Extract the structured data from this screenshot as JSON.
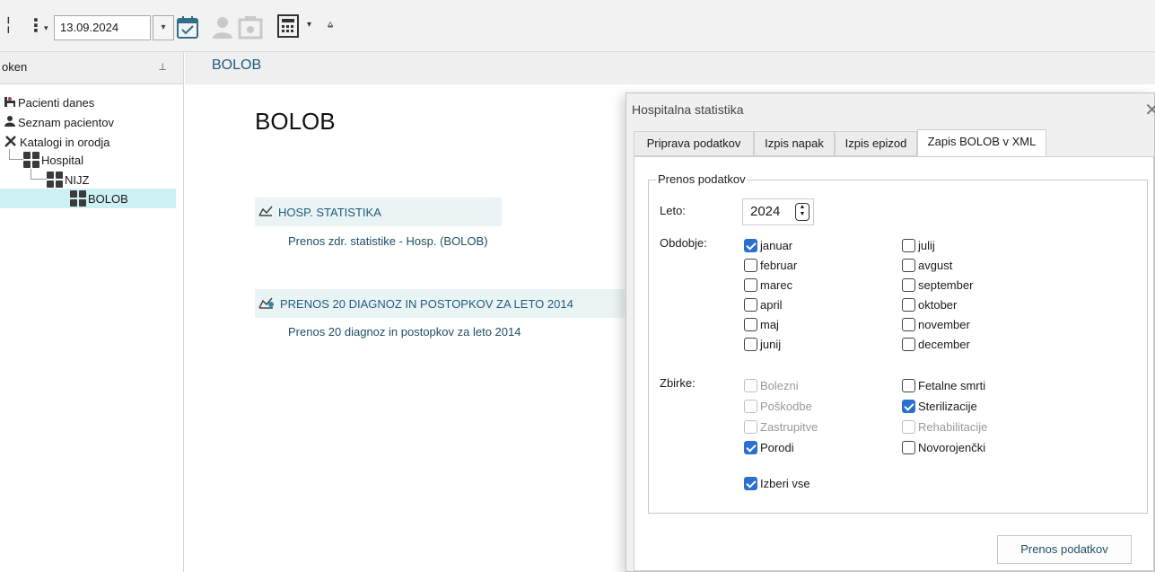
{
  "toolbar": {
    "date_value": "13.09.2024",
    "date_dropdown_icon": "chevron-down-icon",
    "nav_arrow_icon": "chevron-down-icon"
  },
  "left_panel": {
    "title": "oken",
    "pin_glyph": "📌",
    "tree": [
      {
        "label": "Pacienti danes",
        "icon": "bed-icon"
      },
      {
        "label": "Seznam pacientov",
        "icon": "users-icon"
      },
      {
        "label": "Katalogi in orodja",
        "icon": "tools-icon"
      },
      {
        "label": "Hospital",
        "icon": "grid-icon"
      },
      {
        "label": "NIJZ",
        "icon": "grid-icon"
      },
      {
        "label": "BOLOB",
        "icon": "grid-icon"
      }
    ]
  },
  "main": {
    "header_title": "BOLOB",
    "page_title": "BOLOB",
    "sections": [
      {
        "title": "HOSP. STATISTIKA",
        "link": "Prenos zdr. statistike - Hosp. (BOLOB)"
      },
      {
        "title": "PRENOS 20 DIAGNOZ IN POSTOPKOV ZA LETO 2014",
        "link": "Prenos 20 diagnoz in postopkov za leto 2014"
      }
    ]
  },
  "dialog": {
    "title": "Hospitalna statistika",
    "close_glyph": "✕",
    "tabs": [
      "Priprava podatkov",
      "Izpis napak",
      "Izpis epizod",
      "Zapis BOLOB v XML"
    ],
    "active_tab": 3,
    "group_label": "Prenos podatkov",
    "leto_label": "Leto:",
    "leto_value": "2024",
    "obdobje_label": "Obdobje:",
    "months_left": [
      {
        "label": "januar",
        "checked": true
      },
      {
        "label": "februar",
        "checked": false
      },
      {
        "label": "marec",
        "checked": false
      },
      {
        "label": "april",
        "checked": false
      },
      {
        "label": "maj",
        "checked": false
      },
      {
        "label": "junij",
        "checked": false
      }
    ],
    "months_right": [
      {
        "label": "julij",
        "checked": false
      },
      {
        "label": "avgust",
        "checked": false
      },
      {
        "label": "september",
        "checked": false
      },
      {
        "label": "oktober",
        "checked": false
      },
      {
        "label": "november",
        "checked": false
      },
      {
        "label": "december",
        "checked": false
      }
    ],
    "zbirke_label": "Zbirke:",
    "zbirke_left": [
      {
        "label": "Bolezni",
        "checked": false,
        "disabled": true
      },
      {
        "label": "Poškodbe",
        "checked": false,
        "disabled": true
      },
      {
        "label": "Zastrupitve",
        "checked": false,
        "disabled": true
      },
      {
        "label": "Porodi",
        "checked": true,
        "disabled": false
      }
    ],
    "zbirke_right": [
      {
        "label": "Fetalne smrti",
        "checked": false,
        "disabled": false
      },
      {
        "label": "Sterilizacije",
        "checked": true,
        "disabled": false
      },
      {
        "label": "Rehabilitacije",
        "checked": false,
        "disabled": true
      },
      {
        "label": "Novorojenčki",
        "checked": false,
        "disabled": false
      }
    ],
    "select_all": {
      "label": "Izberi vse",
      "checked": true
    },
    "submit_label": "Prenos podatkov"
  },
  "colors": {
    "accent": "#2b6fd0",
    "link": "#1e4e66",
    "selection": "#cdf0f5",
    "section_bg": "#eaf4f5"
  }
}
